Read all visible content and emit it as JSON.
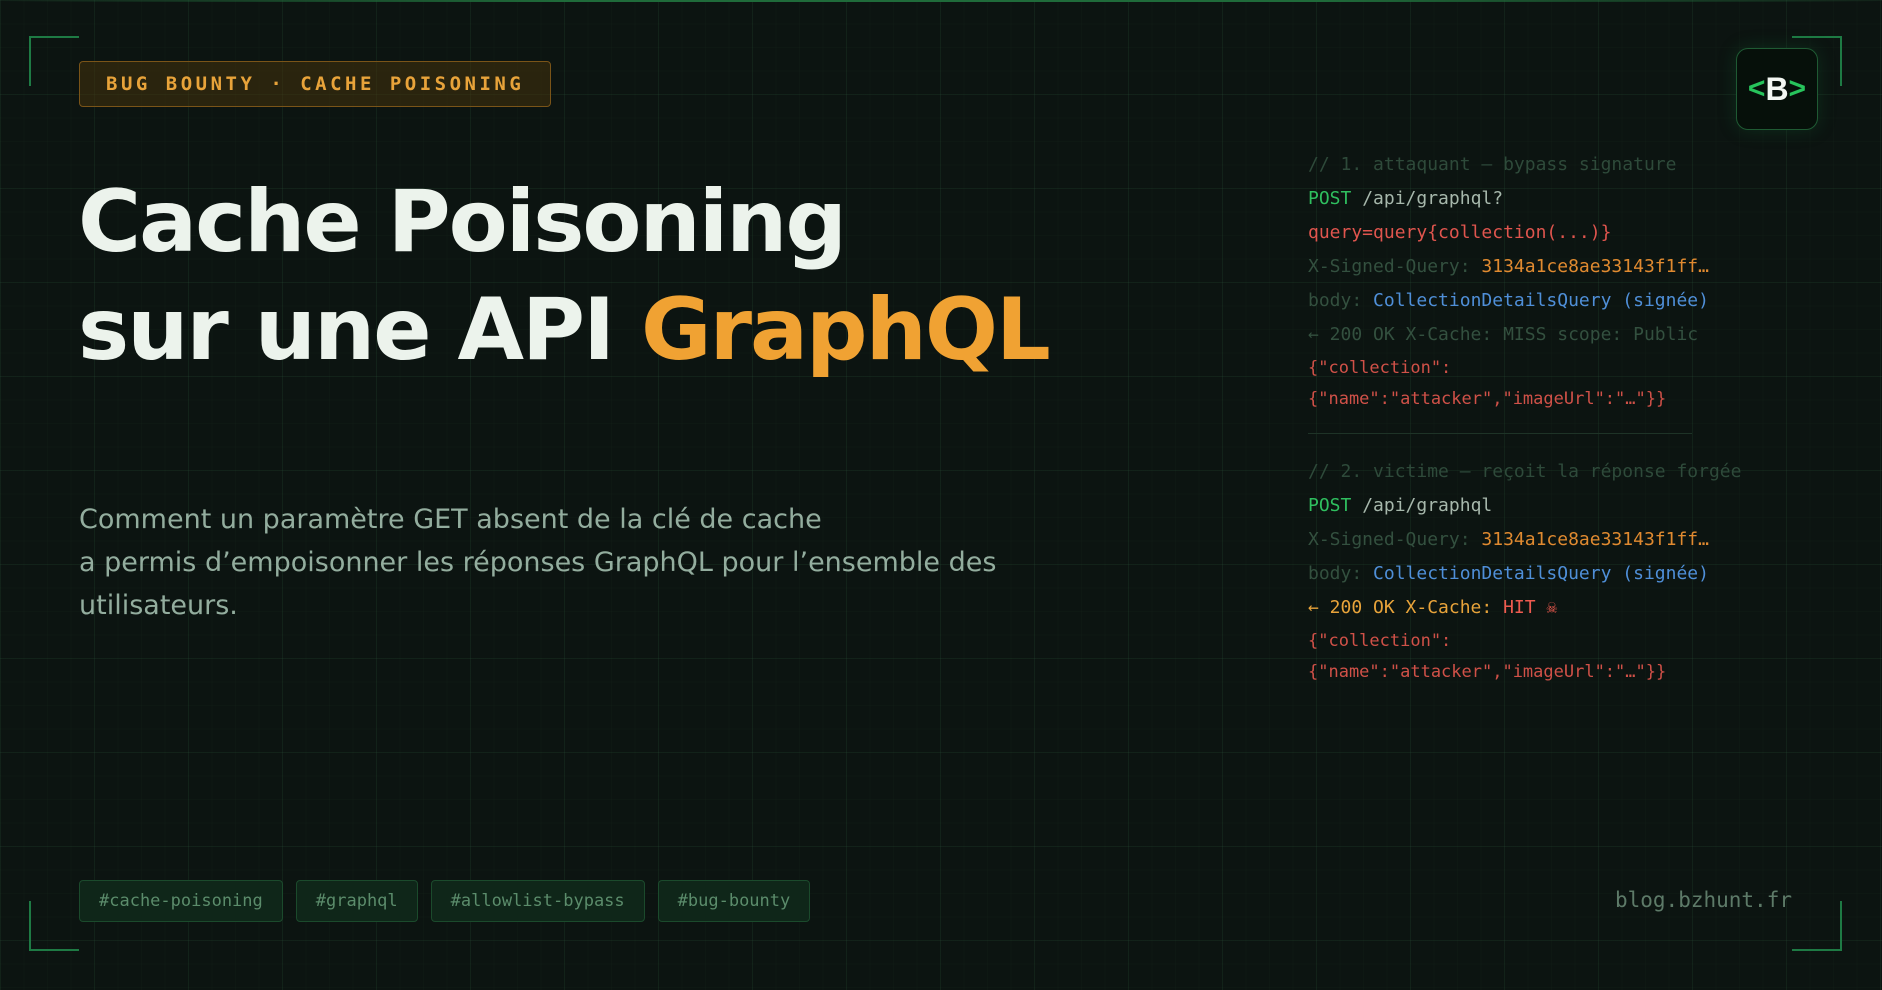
{
  "badge": "BUG BOUNTY · CACHE POISONING",
  "logo": {
    "left": "<",
    "letter": "B",
    "right": ">"
  },
  "title": {
    "line1": "Cache Poisoning",
    "line2_plain": "sur une API ",
    "line2_accent": "GraphQL"
  },
  "subtitle": {
    "line1": "Comment un paramètre GET absent de la clé de cache",
    "line2": "a permis d’empoisonner les réponses GraphQL pour l’ensemble des",
    "line3": "utilisateurs."
  },
  "code": {
    "attacker": {
      "comment": "// 1. attaquant — bypass signature",
      "method": "POST",
      "path": " /api/graphql?",
      "query": "query=query{collection(...)}",
      "sig_label": "X-Signed-Query: ",
      "sig_value": "3134a1ce8ae33143f1ff…",
      "body_label": "body: ",
      "body_value": "CollectionDetailsQuery (signée)",
      "response": "← 200 OK X-Cache: MISS scope: Public",
      "json1": "{\"collection\":",
      "json2": "{\"name\":\"attacker\",\"imageUrl\":\"…\"}}"
    },
    "victim": {
      "comment": "// 2. victime — reçoit la réponse forgée",
      "method": "POST",
      "path": " /api/graphql",
      "sig_label": "X-Signed-Query: ",
      "sig_value": "3134a1ce8ae33143f1ff…",
      "body_label": "body: ",
      "body_value": "CollectionDetailsQuery (signée)",
      "response_prefix": "← 200 OK X-Cache: ",
      "response_hit": "HIT ☠",
      "json1": "{\"collection\":",
      "json2": "{\"name\":\"attacker\",\"imageUrl\":\"…\"}}"
    }
  },
  "tags": [
    "#cache-poisoning",
    "#graphql",
    "#allowlist-bypass",
    "#bug-bounty"
  ],
  "site": "blog.bzhunt.fr",
  "colors": {
    "accent": "#f0a233",
    "brand_green": "#27c45c",
    "background": "#0c1411"
  }
}
